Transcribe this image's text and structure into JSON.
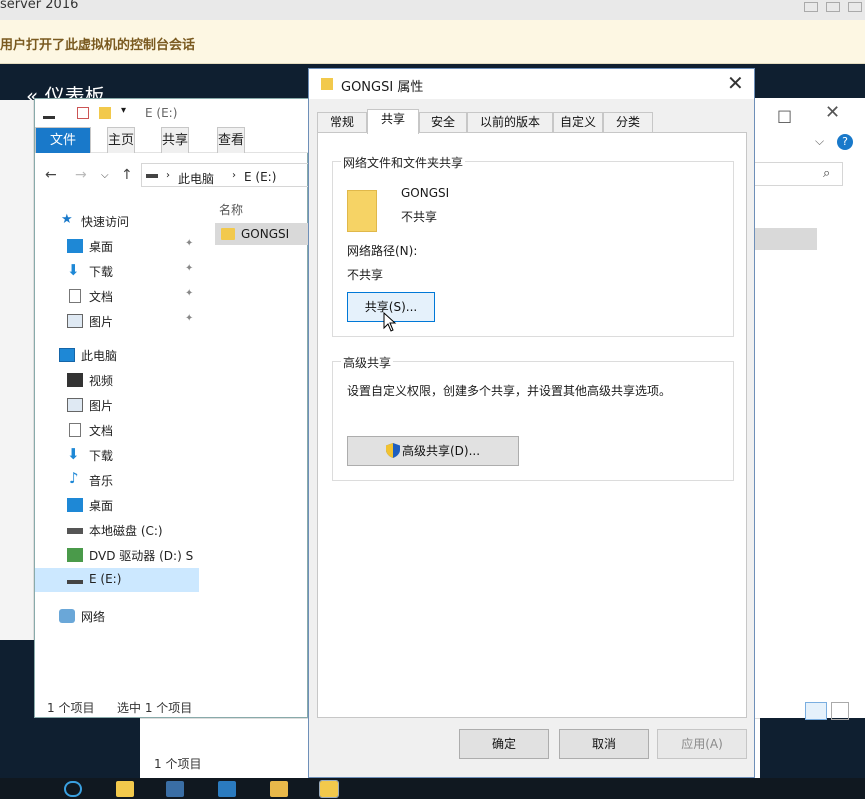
{
  "vm": {
    "title": "server 2016",
    "notice": "用户打开了此虚拟机的控制台会话",
    "desktop_title": "仪表板"
  },
  "explorer": {
    "title_path": "E (E:)",
    "ribbon_tabs": [
      "文件",
      "主页",
      "共享",
      "查看"
    ],
    "address": [
      "此电脑",
      "E (E:)"
    ],
    "nav": {
      "quick_access": "快速访问",
      "quick_items": [
        "桌面",
        "下载",
        "文档",
        "图片"
      ],
      "this_pc": "此电脑",
      "pc_items": [
        "视频",
        "图片",
        "文档",
        "下载",
        "音乐",
        "桌面",
        "本地磁盘 (C:)",
        "DVD 驱动器 (D:) S",
        "E (E:)"
      ],
      "network": "网络"
    },
    "column_header": "名称",
    "file": "GONGSI",
    "status_count": "1 个项目",
    "status_selected": "选中 1 个项目",
    "bottom_count": "1 个项目"
  },
  "dialog": {
    "title": "GONGSI 属性",
    "tabs": [
      "常规",
      "共享",
      "安全",
      "以前的版本",
      "自定义",
      "分类"
    ],
    "active_tab": "共享",
    "network_group": "网络文件和文件夹共享",
    "folder_name": "GONGSI",
    "folder_state": "不共享",
    "network_path_label": "网络路径(N):",
    "network_path_value": "不共享",
    "share_button": "共享(S)...",
    "advanced_group": "高级共享",
    "advanced_desc": "设置自定义权限，创建多个共享，并设置其他高级共享选项。",
    "advanced_button": "高级共享(D)...",
    "ok": "确定",
    "cancel": "取消",
    "apply": "应用(A)"
  },
  "colors": {
    "accent": "#1979ca",
    "selection": "#cce8ff",
    "folder": "#f2c94c"
  }
}
